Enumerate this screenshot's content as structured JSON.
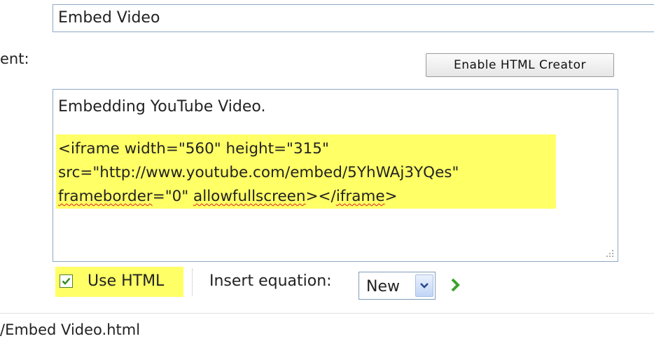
{
  "title_field": {
    "value": "Embed Video"
  },
  "content_label": "ent:",
  "toolbar": {
    "enable_html_creator_label": "Enable HTML Creator"
  },
  "editor": {
    "paragraph": "Embedding YouTube Video.",
    "code": {
      "line1": "<iframe width=\"560\" height=\"315\"",
      "line2": "src=\"http://www.youtube.com/embed/5YhWAj3YQes\"",
      "line3_word1": "frameborder",
      "line3_text1": "=\"0\" ",
      "line3_word2": "allowfullscreen",
      "line3_text2": "></",
      "line3_word3": "iframe",
      "line3_text3": ">"
    },
    "highlight_color": "#ffff66"
  },
  "options": {
    "use_html_label": "Use HTML",
    "use_html_checked": true,
    "insert_equation_label": "Insert equation:",
    "equation_select_value": "New",
    "go_icon": "green-chevron-right-icon"
  },
  "footer": {
    "path": "/Embed Video.html"
  }
}
